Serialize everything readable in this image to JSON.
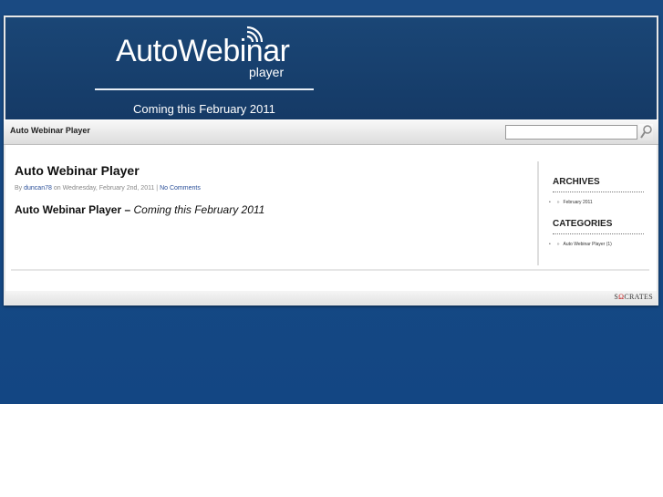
{
  "header": {
    "logo_title": "AutoWebinar",
    "logo_subtitle": "player",
    "tagline": "Coming this February 2011"
  },
  "nav": {
    "site_title": "Auto Webinar Player",
    "search_placeholder": ""
  },
  "post": {
    "title": "Auto Webinar Player",
    "meta_by": "By",
    "author": "duncan78",
    "meta_on": "on Wednesday, February 2nd, 2011 |",
    "comments": "No Comments",
    "body_strong": "Auto Webinar Player –",
    "body_em": "Coming this February 2011"
  },
  "sidebar": {
    "archives_heading": "ARCHIVES",
    "archives": [
      {
        "label": "February 2011"
      }
    ],
    "categories_heading": "CATEGORIES",
    "categories": [
      {
        "label": "Auto Webinar Player (1)"
      }
    ]
  },
  "footer": {
    "theme_logo_left": "S",
    "theme_logo_omega": "Ω",
    "theme_logo_right": "CRATES"
  }
}
